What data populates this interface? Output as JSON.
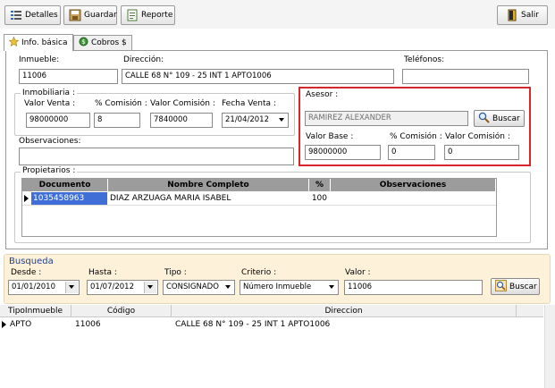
{
  "toolbar": {
    "detalles": "Detalles",
    "guardar": "Guardar",
    "reporte": "Reporte",
    "salir": "Salir"
  },
  "tabs": {
    "info": "Info. básica",
    "cobros": "Cobros $"
  },
  "form": {
    "inmueble_label": "Inmueble:",
    "inmueble_value": "11006",
    "direccion_label": "Dirección:",
    "direccion_value": "CALLE 68 N° 109 - 25 INT 1 APTO1006",
    "telefonos_label": "Teléfonos:",
    "telefonos_value": ""
  },
  "inmobiliaria": {
    "title": "Inmobiliaria :",
    "valor_venta_label": "Valor Venta :",
    "valor_venta_value": "98000000",
    "pct_comision_label": "% Comisión :",
    "pct_comision_value": "8",
    "valor_comision_label": "Valor Comisión :",
    "valor_comision_value": "7840000",
    "fecha_venta_label": "Fecha Venta :",
    "fecha_venta_value": "21/04/2012"
  },
  "observaciones": {
    "label": "Observaciones:",
    "value": ""
  },
  "asesor": {
    "title": "Asesor :",
    "name_value": "RAMIREZ  ALEXANDER",
    "buscar_label": "Buscar",
    "valor_base_label": "Valor Base :",
    "valor_base_value": "98000000",
    "pct_comision_label": "% Comisión :",
    "pct_comision_value": "0",
    "valor_comision_label": "Valor Comisión :",
    "valor_comision_value": "0",
    "highlight_color": "#d9262b"
  },
  "propietarios": {
    "title": "Propietarios :",
    "columns": [
      "Documento",
      "Nombre Completo",
      "%",
      "Observaciones"
    ],
    "rows": [
      {
        "documento": "1035458963",
        "nombre": "DIAZ ARZUAGA MARIA ISABEL",
        "pct": "100",
        "obs": ""
      }
    ]
  },
  "busqueda": {
    "title": "Busqueda",
    "desde_label": "Desde :",
    "desde_value": "01/01/2010",
    "hasta_label": "Hasta :",
    "hasta_value": "01/07/2012",
    "tipo_label": "Tipo :",
    "tipo_value": "CONSIGNADO",
    "criterio_label": "Criterio :",
    "criterio_value": "Número Inmueble",
    "valor_label": "Valor :",
    "valor_value": "11006",
    "buscar_label": "Buscar"
  },
  "results": {
    "columns": [
      "TipoInmueble",
      "Código",
      "Direccion"
    ],
    "rows": [
      {
        "tipo": "APTO",
        "codigo": "11006",
        "direccion": "CALLE 68 N° 109 - 25 INT 1 APTO1006"
      }
    ]
  },
  "colors": {
    "search_bg": "#fdf1da",
    "search_title": "#1f3f8c",
    "grid_header": "#9c9c9c",
    "selected_cell": "#3f6fd6"
  }
}
